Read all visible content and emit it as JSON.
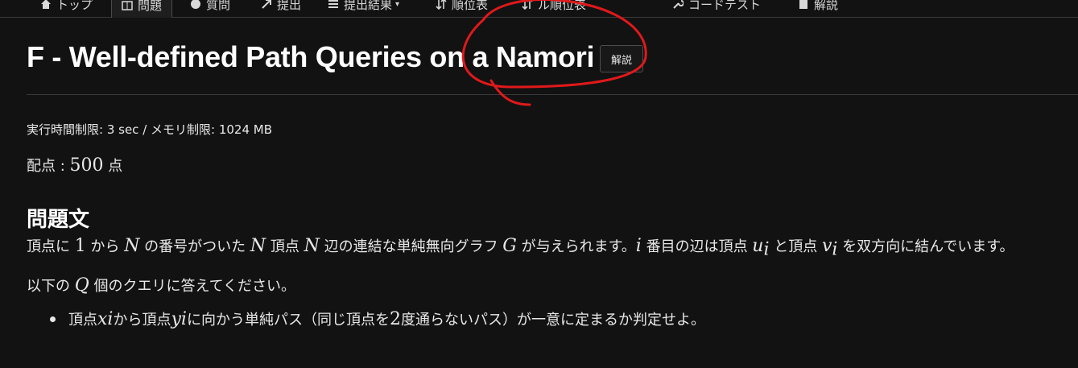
{
  "nav": {
    "tabs": [
      {
        "label": "トップ",
        "icon": "home-icon"
      },
      {
        "label": "問題",
        "icon": "book-icon",
        "active": true
      },
      {
        "label": "質問",
        "icon": "info-icon"
      },
      {
        "label": "提出",
        "icon": "send-icon"
      },
      {
        "label": "提出結果",
        "icon": "list-icon"
      },
      {
        "label": "順位表",
        "icon": "sort-icon"
      },
      {
        "label": "ル順位表",
        "icon": "sort-icon"
      },
      {
        "label": "コードテスト",
        "icon": "wrench-icon"
      },
      {
        "label": "解説",
        "icon": "file-icon"
      }
    ]
  },
  "problem": {
    "title": "F - Well-defined Path Queries on a Namori",
    "editorial_button": "解説",
    "limits": "実行時間制限: 3 sec / メモリ制限: 1024 MB",
    "score_label": "配点 : ",
    "score_value": "500",
    "score_unit": " 点",
    "section_heading": "問題文"
  },
  "statement": {
    "p1": {
      "t1": "頂点に ",
      "m1": "1",
      "t2": " から ",
      "m2": "N",
      "t3": " の番号がついた ",
      "m3": "N",
      "t4": " 頂点 ",
      "m4": "N",
      "t5": " 辺の連結な単純無向グラフ ",
      "m5": "G",
      "t6": " が与えられます。",
      "m6": "i",
      "t7": " 番目の辺は頂点 ",
      "m7": "u",
      "m7s": "i",
      "t8": " と頂点 ",
      "m8": "v",
      "m8s": "i",
      "t9": " を双方向に結んでいます。"
    },
    "p2": {
      "t1": "以下の ",
      "m1": "Q",
      "t2": " 個のクエリに答えてください。"
    },
    "bullet": {
      "t1": "頂点 ",
      "m1": "x",
      "m1s": "i",
      "t2": " から頂点 ",
      "m2": "y",
      "m2s": "i",
      "t3": " に向かう単純パス（同じ頂点を ",
      "m3": "2",
      "t4": " 度通らないパス）が一意に定まるか判定せよ。"
    }
  },
  "colors": {
    "background": "#121212",
    "text": "#e8e8e8",
    "annotation": "#e0191b"
  }
}
